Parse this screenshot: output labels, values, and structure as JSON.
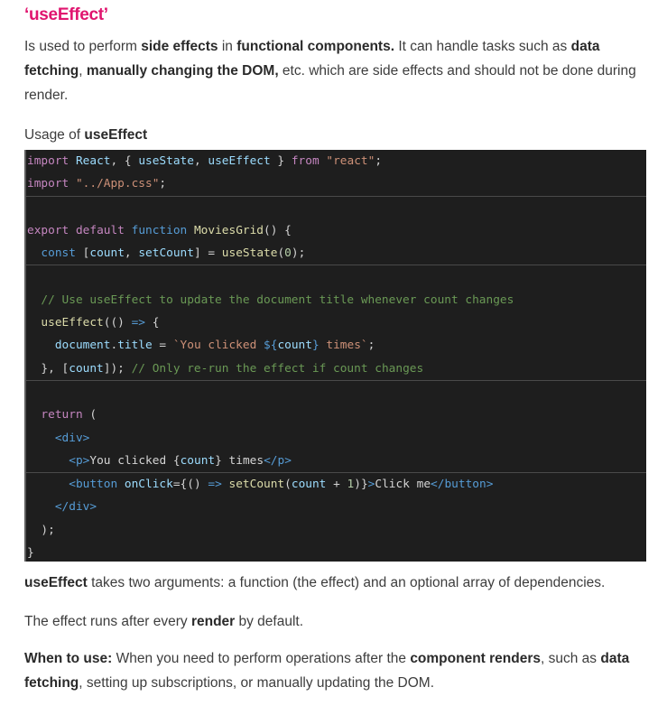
{
  "heading": "‘useEffect’",
  "intro": {
    "t1": "Is used to perform ",
    "b1": "side effects",
    "t2": " in ",
    "b2": "functional components.",
    "t3": " It can handle tasks such as ",
    "b3": "data fetching",
    "t4": ", ",
    "b4": "manually changing the DOM,",
    "t5": " etc. which are side effects and should not be done during render."
  },
  "usage": {
    "t1": "Usage of ",
    "b1": "useEffect"
  },
  "code_lines": [
    "import React, { useState, useEffect } from \"react\";",
    "import \"../App.css\";",
    "",
    "export default function MoviesGrid() {",
    "  const [count, setCount] = useState(0);",
    "",
    "  // Use useEffect to update the document title whenever count changes",
    "  useEffect(() => {",
    "    document.title = `You clicked ${count} times`;",
    "  }, [count]); // Only re-run the effect if count changes",
    "",
    "  return (",
    "    <div>",
    "      <p>You clicked {count} times</p>",
    "      <button onClick={() => setCount(count + 1)}>Click me</button>",
    "    </div>",
    "  );",
    "}"
  ],
  "args": {
    "b1": "useEffect",
    "t1": " takes two arguments: a function (the effect) and an optional array of dependencies."
  },
  "runs": {
    "t1": "The effect runs after every ",
    "b1": "render",
    "t2": " by default."
  },
  "when": {
    "b1": "When to use:",
    "t1": " When you need to perform operations after the ",
    "b2": "component renders",
    "t2": ", such as ",
    "b3": "data fetching",
    "t3": ", setting up subscriptions, or manually updating the DOM."
  },
  "colors": {
    "heading": "#e0156f",
    "code_bg": "#1e1e1e",
    "keyword": "#c586c0",
    "string": "#ce9178",
    "comment": "#6a9955",
    "function": "#dcdcaa",
    "variable": "#9cdcfe"
  }
}
